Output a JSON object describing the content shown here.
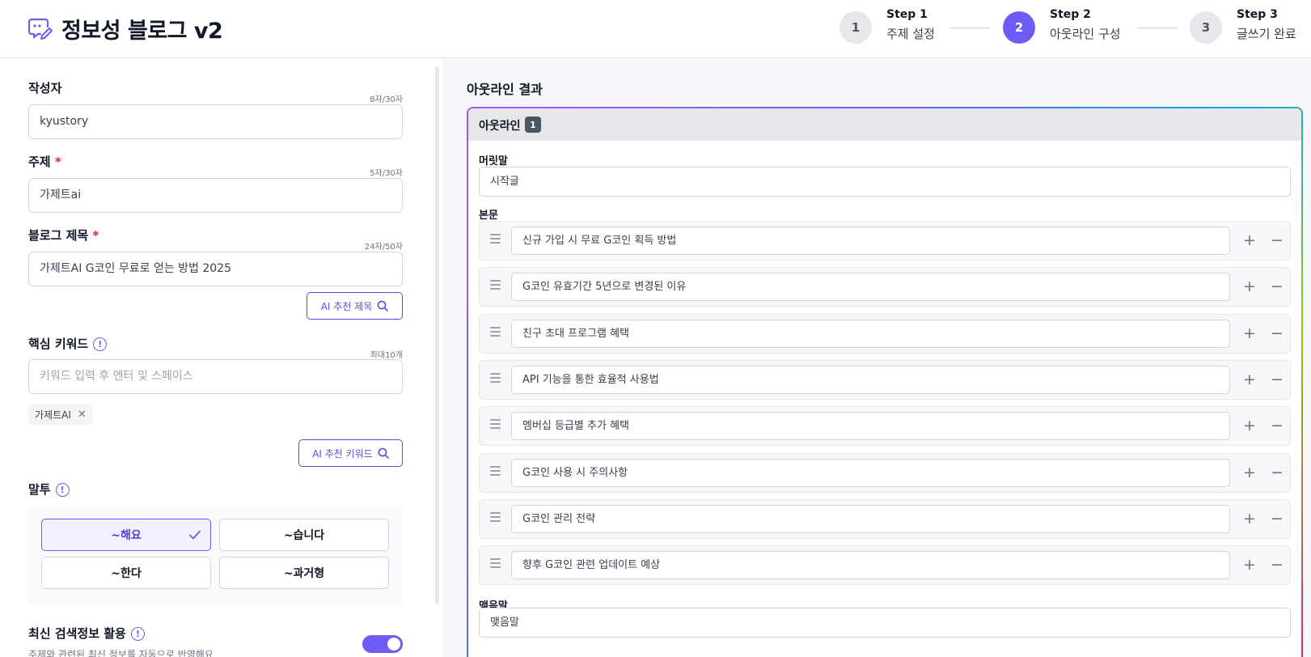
{
  "header": {
    "title": "정보성 블로그 v2",
    "steps": [
      {
        "num": "1",
        "name": "Step 1",
        "sub": "주제 설정"
      },
      {
        "num": "2",
        "name": "Step 2",
        "sub": "아웃라인 구성"
      },
      {
        "num": "3",
        "name": "Step 3",
        "sub": "글쓰기 완료"
      }
    ],
    "active_step": 2
  },
  "form": {
    "author": {
      "label": "작성자",
      "counter": "8자/30자",
      "value": "kyustory"
    },
    "topic": {
      "label": "주제",
      "required": "*",
      "counter": "5자/30자",
      "value": "가제트ai"
    },
    "blog_title": {
      "label": "블로그 제목",
      "required": "*",
      "counter": "24자/50자",
      "value": "가제트AI G코인 무료로 얻는 방법 2025",
      "ai_button": "AI 추천 제목"
    },
    "keywords": {
      "label": "핵심 키워드",
      "counter": "최대10개",
      "placeholder": "키워드 입력 후 엔터 및 스페이스",
      "chips": [
        "가제트AI"
      ],
      "ai_button": "AI 추천 키워드"
    },
    "tone": {
      "label": "말투",
      "options": [
        "~해요",
        "~습니다",
        "~한다",
        "~과거형"
      ],
      "selected": "~해요"
    },
    "latest": {
      "label": "최신 검색정보 활용",
      "sub": "주제와 관련된 최신 정보를 자동으로 반영해요",
      "enabled": true
    }
  },
  "outline": {
    "title": "아웃라인 결과",
    "card_label": "아웃라인",
    "card_badge": "1",
    "intro_label": "머릿말",
    "intro_value": "시작글",
    "body_label": "본문",
    "body_items": [
      "신규 가입 시 무료 G코인 획득 방법",
      "G코인 유효기간 5년으로 변경된 이유",
      "친구 초대 프로그램 혜택",
      "API 기능을 통한 효율적 사용법",
      "멤버십 등급별 추가 혜택",
      "G코인 사용 시 주의사항",
      "G코인 관리 전략",
      "향후 G코인 관련 업데이트 예상"
    ],
    "outro_label": "맺음말",
    "outro_value": "맺음말"
  },
  "colors": {
    "accent": "#6d5cf5",
    "required": "#e11d48"
  },
  "icons": {
    "logo": "chat-pencil-icon",
    "info": "info-icon",
    "search": "search-icon",
    "close": "close-icon",
    "check": "check-icon",
    "drag": "drag-handle-icon",
    "plus": "plus-icon",
    "minus": "minus-icon"
  }
}
